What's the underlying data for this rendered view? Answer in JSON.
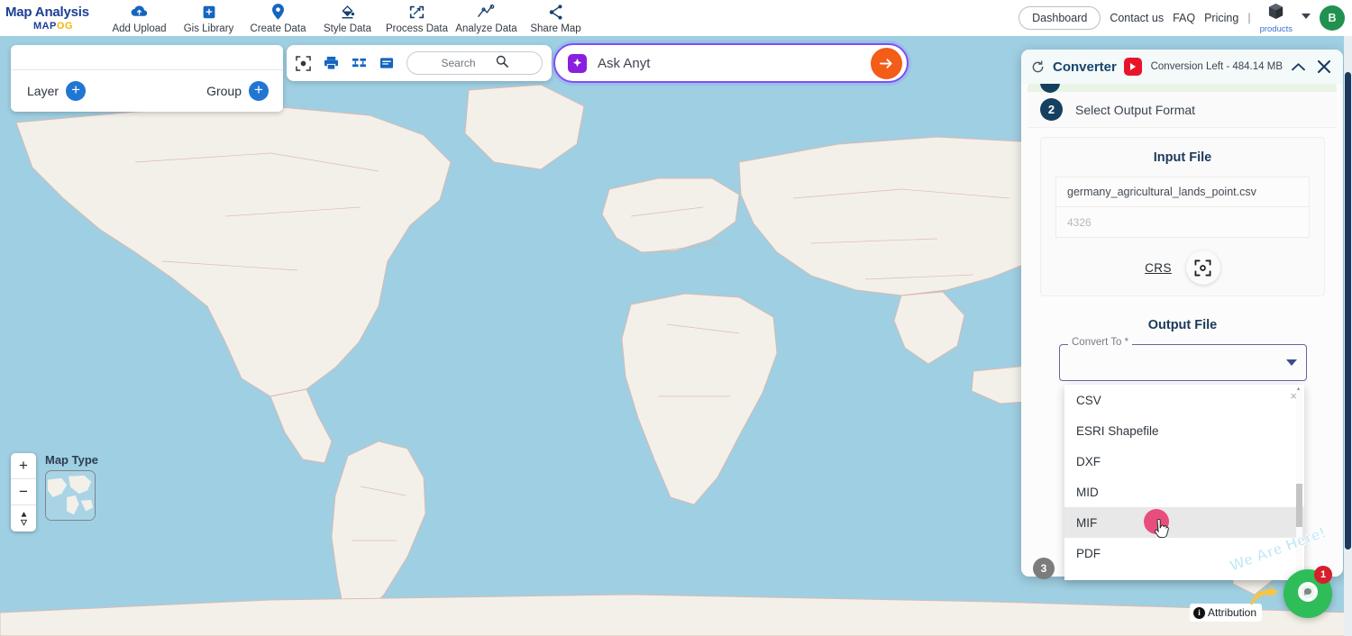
{
  "nav": {
    "brand_title": "Map Analysis",
    "brand_sub_main": "MAP",
    "brand_sub_accent": "OG",
    "items": [
      {
        "label": "Add Upload",
        "icon": "cloud-upload-icon"
      },
      {
        "label": "Gis Library",
        "icon": "library-icon"
      },
      {
        "label": "Create Data",
        "icon": "map-pin-icon"
      },
      {
        "label": "Style Data",
        "icon": "paint-bucket-icon"
      },
      {
        "label": "Process Data",
        "icon": "process-icon"
      },
      {
        "label": "Analyze Data",
        "icon": "analyze-icon"
      },
      {
        "label": "Share Map",
        "icon": "share-icon"
      }
    ],
    "dashboard": "Dashboard",
    "contact": "Contact us",
    "faq": "FAQ",
    "pricing": "Pricing",
    "separator": "|",
    "products_label": "products",
    "avatar_initial": "B"
  },
  "layer_panel": {
    "layer_label": "Layer",
    "group_label": "Group",
    "add_symbol": "+"
  },
  "map_toolbar": {
    "icons": [
      "fit-extent-icon",
      "print-icon",
      "compare-icon",
      "legend-icon"
    ],
    "search_placeholder": "Search"
  },
  "ask_bar": {
    "icon": "ai-sparkle-icon",
    "text": "Ask Anyt",
    "go_icon": "arrow-right-icon"
  },
  "map_controls": {
    "zoom_in": "+",
    "zoom_out": "−",
    "compass": "compass-icon",
    "map_type_label": "Map Type"
  },
  "attribution": {
    "info": "i",
    "label": "Attribution"
  },
  "converter": {
    "refresh_icon": "refresh-icon",
    "title": "Converter",
    "video_icon": "youtube-play-icon",
    "conversion_left": "Conversion Left - 484.14 MB",
    "collapse_icon": "chevron-up-icon",
    "close_icon": "close-icon",
    "step2_number": "2",
    "step2_label": "Select Output Format",
    "step3_number": "3",
    "input_card": {
      "title": "Input File",
      "file_name": "germany_agricultural_lands_point.csv",
      "crs_placeholder": "4326",
      "crs_label": "CRS",
      "crs_picker_icon": "crosshair-icon"
    },
    "output_card": {
      "title": "Output File",
      "select_legend": "Convert To *",
      "select_value": "",
      "caret_icon": "chevron-down-icon"
    },
    "dropdown": {
      "close_icon": "×",
      "items": [
        {
          "label": "CSV",
          "hovered": false
        },
        {
          "label": "ESRI Shapefile",
          "hovered": false
        },
        {
          "label": "DXF",
          "hovered": false
        },
        {
          "label": "MID",
          "hovered": false
        },
        {
          "label": "MIF",
          "hovered": true
        },
        {
          "label": "PDF",
          "hovered": false
        }
      ]
    }
  },
  "chat": {
    "we_are_here": "We Are Here!",
    "badge_count": "1",
    "icon": "chat-bubble-icon"
  },
  "colors": {
    "brand_blue": "#1d3f94",
    "accent_yellow": "#f2b70a",
    "ocean": "#9fcfe2",
    "land": "#f3f0e9",
    "purple_border": "#6f5f9e",
    "orange": "#f35c19",
    "navy": "#16405f",
    "green_avatar": "#219150",
    "chat_green": "#2ebd59",
    "red_badge": "#d61f2b"
  }
}
